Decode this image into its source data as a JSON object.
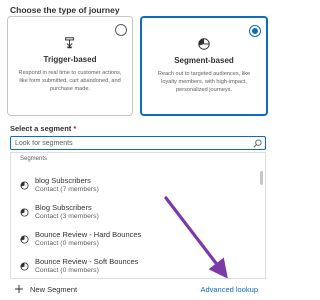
{
  "heading": "Choose the type of journey",
  "cards": {
    "trigger": {
      "title": "Trigger-based",
      "description": "Respond in real time to customer actions, like form submitted, cart abandoned, and purchase made.",
      "selected": false
    },
    "segment": {
      "title": "Segment-based",
      "description": "Reach out to targeted audiences, like loyalty members, with high-impact, personalized journeys.",
      "selected": true
    }
  },
  "select_segment": {
    "label": "Select a segment",
    "required_mark": "*",
    "search_placeholder": "Look for segments"
  },
  "dropdown": {
    "section_label": "Segments",
    "items": [
      {
        "name": "blog Subscribers",
        "meta": "Contact (7 members)"
      },
      {
        "name": "Blog Subscribers",
        "meta": "Contact (3 members)"
      },
      {
        "name": "Bounce Review - Hard Bounces",
        "meta": "Contact (0 members)"
      },
      {
        "name": "Bounce Review - Soft Bounces",
        "meta": "Contact (0 members)"
      }
    ]
  },
  "footer": {
    "new_segment": "New Segment",
    "advanced_lookup": "Advanced lookup"
  },
  "colors": {
    "accent": "#0f6cbd",
    "arrow": "#7b3aa6",
    "text": "#323130",
    "muted": "#605e5c"
  }
}
